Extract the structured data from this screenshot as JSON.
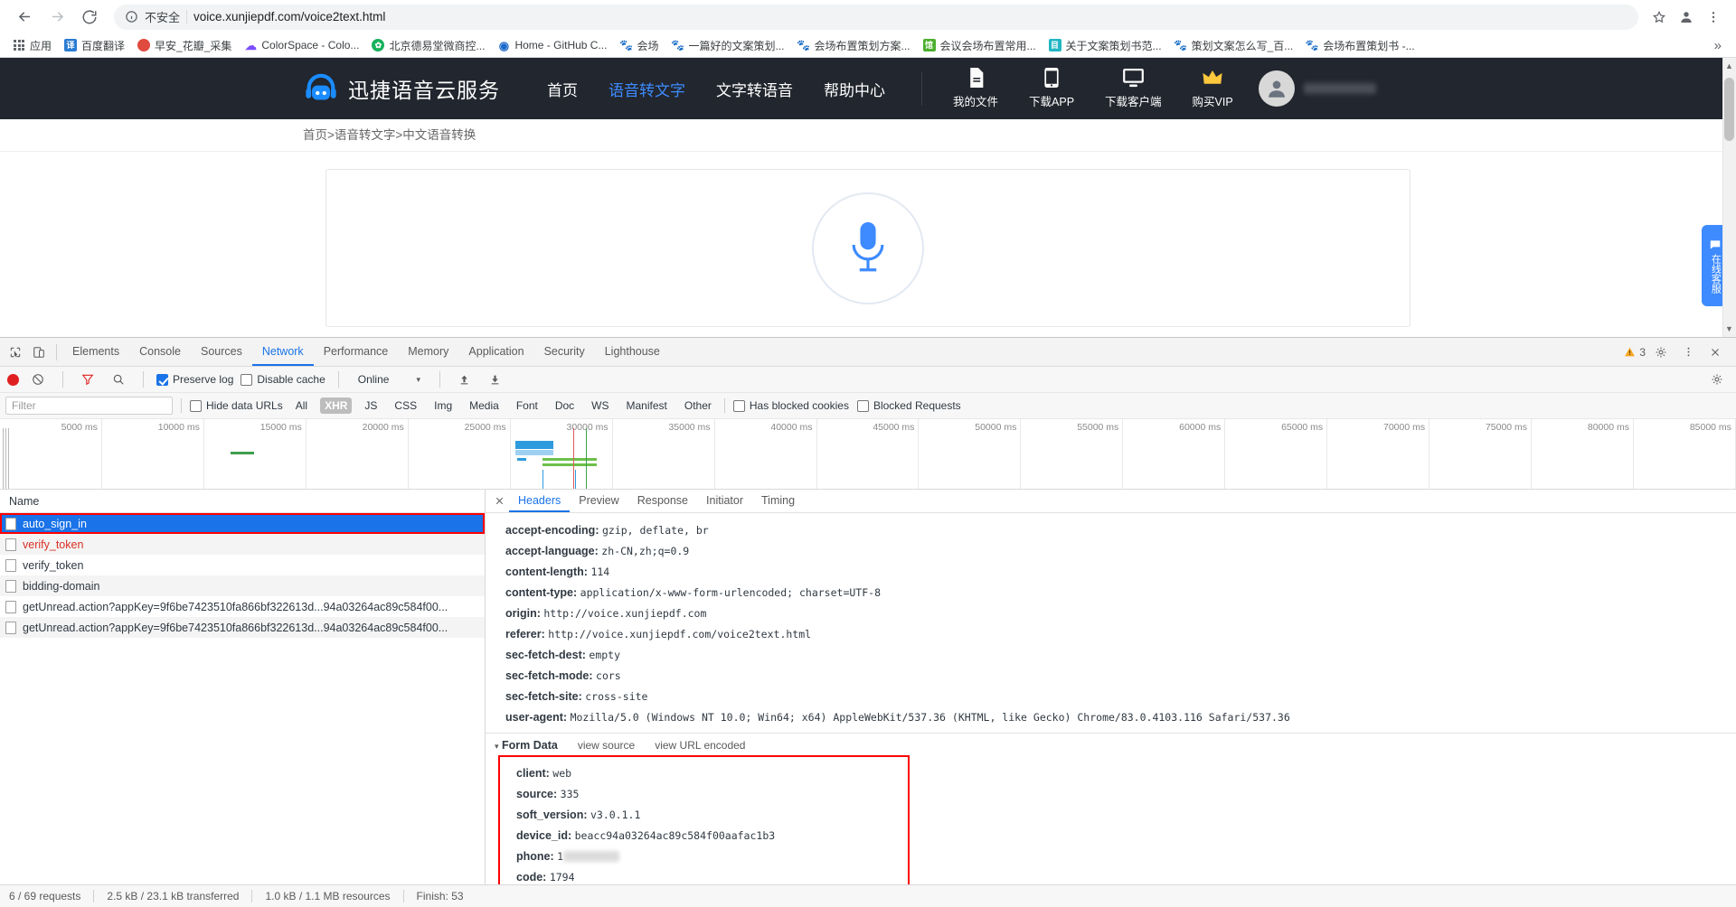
{
  "browser": {
    "back_icon": "back-arrow-icon",
    "forward_icon": "forward-arrow-icon",
    "reload_icon": "reload-icon",
    "security_label": "不安全",
    "url": "voice.xunjiepdf.com/voice2text.html",
    "star_icon": "bookmark-star-icon",
    "profile_icon": "profile-avatar-icon",
    "menu_icon": "chrome-menu-icon",
    "overflow_label": "»",
    "bookmarks": [
      {
        "label": "应用",
        "icon": "apps-grid-icon"
      },
      {
        "label": "百度翻译",
        "icon": "baidu-translate-icon"
      },
      {
        "label": "早安_花瓣_采集",
        "icon": "huaban-icon"
      },
      {
        "label": "ColorSpace - Colo...",
        "icon": "colorspace-icon"
      },
      {
        "label": "北京德易堂微商控...",
        "icon": "deyitang-icon"
      },
      {
        "label": "Home - GitHub C...",
        "icon": "github-icon"
      },
      {
        "label": "会场",
        "icon": "baidu-paw-icon"
      },
      {
        "label": "一篇好的文案策划...",
        "icon": "baidu-paw-icon"
      },
      {
        "label": "会场布置策划方案...",
        "icon": "baidu-paw-icon"
      },
      {
        "label": "会议会场布置常用...",
        "icon": "guan-icon"
      },
      {
        "label": "关于文案策划书范...",
        "icon": "doc-teal-icon"
      },
      {
        "label": "策划文案怎么写_百...",
        "icon": "baidu-paw-icon"
      },
      {
        "label": "会场布置策划书 -...",
        "icon": "baidu-paw-icon"
      }
    ]
  },
  "site": {
    "brand": "迅捷语音云服务",
    "logo_icon": "headphone-robot-logo-icon",
    "nav": [
      {
        "label": "首页",
        "active": false
      },
      {
        "label": "语音转文字",
        "active": true
      },
      {
        "label": "文字转语音",
        "active": false
      },
      {
        "label": "帮助中心",
        "active": false
      }
    ],
    "tools": [
      {
        "label": "我的文件",
        "icon": "document-icon"
      },
      {
        "label": "下载APP",
        "icon": "mobile-phone-icon"
      },
      {
        "label": "下载客户端",
        "icon": "desktop-monitor-icon"
      },
      {
        "label": "购买VIP",
        "icon": "vip-crown-icon"
      }
    ],
    "avatar_icon": "user-avatar-icon",
    "breadcrumb": "首页>语音转文字>中文语音转换",
    "mic_icon": "microphone-icon",
    "chat_widget": "在线客服"
  },
  "devtools": {
    "inspect_icon": "inspect-element-icon",
    "device_icon": "device-toolbar-icon",
    "tabs": [
      {
        "label": "Elements",
        "active": false
      },
      {
        "label": "Console",
        "active": false
      },
      {
        "label": "Sources",
        "active": false
      },
      {
        "label": "Network",
        "active": true
      },
      {
        "label": "Performance",
        "active": false
      },
      {
        "label": "Memory",
        "active": false
      },
      {
        "label": "Application",
        "active": false
      },
      {
        "label": "Security",
        "active": false
      },
      {
        "label": "Lighthouse",
        "active": false
      }
    ],
    "warning_count": "3",
    "warning_icon": "warning-triangle-icon",
    "settings_icon": "gear-icon",
    "more_icon": "vertical-dots-icon",
    "close_icon": "close-icon",
    "toolbar": {
      "record_icon": "record-stop-icon",
      "clear_icon": "clear-icon",
      "filter_icon": "filter-funnel-icon",
      "search_icon": "search-icon",
      "preserve_log": "Preserve log",
      "preserve_log_checked": true,
      "disable_cache": "Disable cache",
      "disable_cache_checked": false,
      "throttling": "Online",
      "throttling_caret": "▾",
      "import_icon": "import-har-icon",
      "export_icon": "export-har-icon",
      "settings_icon": "network-settings-icon"
    },
    "filter": {
      "placeholder": "Filter",
      "value": "",
      "hide_data_urls": "Hide data URLs",
      "hide_data_urls_checked": false,
      "types": [
        {
          "label": "All",
          "active": false
        },
        {
          "label": "XHR",
          "active": true
        },
        {
          "label": "JS",
          "active": false
        },
        {
          "label": "CSS",
          "active": false
        },
        {
          "label": "Img",
          "active": false
        },
        {
          "label": "Media",
          "active": false
        },
        {
          "label": "Font",
          "active": false
        },
        {
          "label": "Doc",
          "active": false
        },
        {
          "label": "WS",
          "active": false
        },
        {
          "label": "Manifest",
          "active": false
        },
        {
          "label": "Other",
          "active": false
        }
      ],
      "has_blocked_cookies": "Has blocked cookies",
      "has_blocked_cookies_checked": false,
      "blocked_requests": "Blocked Requests",
      "blocked_requests_checked": false
    },
    "overview_ticks": [
      "5000 ms",
      "10000 ms",
      "15000 ms",
      "20000 ms",
      "25000 ms",
      "30000 ms",
      "35000 ms",
      "40000 ms",
      "45000 ms",
      "50000 ms",
      "55000 ms",
      "60000 ms",
      "65000 ms",
      "70000 ms",
      "75000 ms",
      "80000 ms",
      "85000 ms"
    ],
    "requests_header": "Name",
    "requests": [
      {
        "name": "auto_sign_in",
        "selected": true,
        "error": false
      },
      {
        "name": "verify_token",
        "selected": false,
        "error": true
      },
      {
        "name": "verify_token",
        "selected": false,
        "error": false
      },
      {
        "name": "bidding-domain",
        "selected": false,
        "error": false
      },
      {
        "name": "getUnread.action?appKey=9f6be7423510fa866bf322613d...94a03264ac89c584f00...",
        "selected": false,
        "error": false
      },
      {
        "name": "getUnread.action?appKey=9f6be7423510fa866bf322613d...94a03264ac89c584f00...",
        "selected": false,
        "error": false
      }
    ],
    "detail_tabs": [
      {
        "label": "Headers",
        "active": true
      },
      {
        "label": "Preview",
        "active": false
      },
      {
        "label": "Response",
        "active": false
      },
      {
        "label": "Initiator",
        "active": false
      },
      {
        "label": "Timing",
        "active": false
      }
    ],
    "headers": [
      {
        "key": "accept-encoding:",
        "value": "gzip, deflate, br"
      },
      {
        "key": "accept-language:",
        "value": "zh-CN,zh;q=0.9"
      },
      {
        "key": "content-length:",
        "value": "114"
      },
      {
        "key": "content-type:",
        "value": "application/x-www-form-urlencoded; charset=UTF-8"
      },
      {
        "key": "origin:",
        "value": "http://voice.xunjiepdf.com"
      },
      {
        "key": "referer:",
        "value": "http://voice.xunjiepdf.com/voice2text.html"
      },
      {
        "key": "sec-fetch-dest:",
        "value": "empty"
      },
      {
        "key": "sec-fetch-mode:",
        "value": "cors"
      },
      {
        "key": "sec-fetch-site:",
        "value": "cross-site"
      },
      {
        "key": "user-agent:",
        "value": "Mozilla/5.0 (Windows NT 10.0; Win64; x64) AppleWebKit/537.36 (KHTML, like Gecko) Chrome/83.0.4103.116 Safari/537.36"
      }
    ],
    "form_data": {
      "title": "Form Data",
      "triangle": "▾",
      "view_source": "view source",
      "view_url_encoded": "view URL encoded",
      "rows": [
        {
          "key": "client:",
          "value": "web",
          "redacted": false
        },
        {
          "key": "source:",
          "value": "335",
          "redacted": false
        },
        {
          "key": "soft_version:",
          "value": "v3.0.1.1",
          "redacted": false
        },
        {
          "key": "device_id:",
          "value": "beacc94a03264ac89c584f00aafac1b3",
          "redacted": false
        },
        {
          "key": "phone:",
          "value": "1",
          "redacted": true
        },
        {
          "key": "code:",
          "value": "1794",
          "redacted": false
        }
      ]
    },
    "status": [
      "6 / 69 requests",
      "2.5 kB / 23.1 kB transferred",
      "1.0 kB / 1.1 MB resources",
      "Finish: 53"
    ]
  },
  "colors": {
    "accent": "#1a73e8",
    "header_bg": "#22262e",
    "brand_blue": "#3d8bff",
    "record_red": "#e02020",
    "highlight_red": "#ff0000",
    "error_red": "#d93025"
  }
}
